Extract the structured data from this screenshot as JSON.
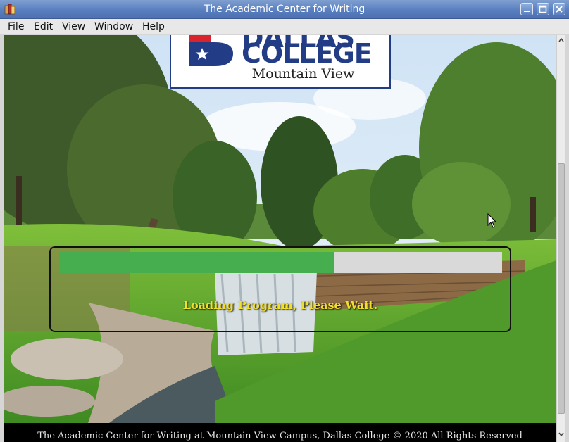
{
  "window": {
    "title": "The Academic Center for Writing",
    "controls": [
      "minimize-icon",
      "maximize-icon",
      "close-icon"
    ]
  },
  "menu": {
    "items": [
      "File",
      "Edit",
      "View",
      "Window",
      "Help"
    ]
  },
  "logo": {
    "line1": "DALLAS",
    "line2": "COLLEGE",
    "subtitle": "Mountain View",
    "brand_blue": "#233c86",
    "brand_red": "#d9242e"
  },
  "loading": {
    "message": "Loading Program, Please Wait.",
    "progress_fraction": 0.62,
    "progress_color": "#46ae4e",
    "track_color": "#d9d9d9",
    "text_color": "#f2df2a"
  },
  "footer": {
    "text": "The Academic Center for Writing at Mountain View Campus, Dallas College © 2020 All Rights Reserved"
  },
  "colors": {
    "titlebar": "#5a7fbf",
    "menubar": "#e8e8e8"
  }
}
